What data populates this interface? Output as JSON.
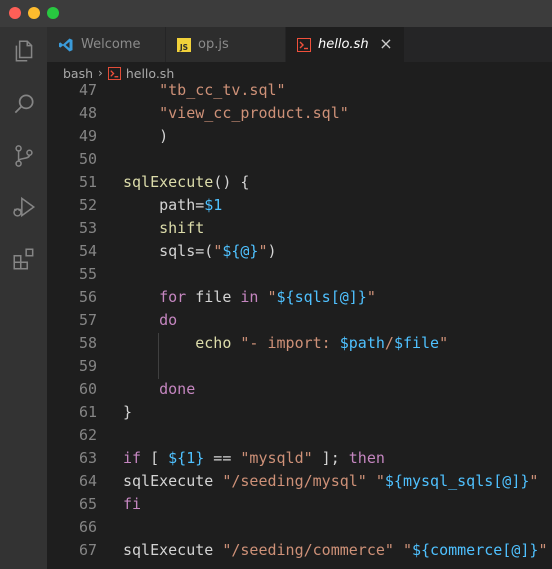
{
  "colors": {
    "keyword": "#c586c0",
    "string": "#ce9178",
    "variable": "#4fc1ff",
    "function": "#dcdcaa",
    "plain": "#d4d4d4",
    "line_number": "#858585",
    "editor_bg": "#1e1e1e",
    "accent_vscode_blue": "#3b9cdb",
    "js_yellow": "#f1d13a",
    "shell_orange": "#f0503b"
  },
  "activity_bar": [
    {
      "name": "explorer-icon"
    },
    {
      "name": "search-icon"
    },
    {
      "name": "source-control-icon"
    },
    {
      "name": "run-debug-icon"
    },
    {
      "name": "extensions-icon"
    }
  ],
  "tabs": [
    {
      "label": "Welcome",
      "icon": "vscode-logo-icon",
      "active": false
    },
    {
      "label": "op.js",
      "icon": "js-file-icon",
      "active": false
    },
    {
      "label": "hello.sh",
      "icon": "shell-file-icon",
      "active": true,
      "close_symbol": "×"
    }
  ],
  "breadcrumbs": {
    "folder": "bash",
    "separator": "›",
    "file": "hello.sh",
    "file_icon": "shell-file-icon"
  },
  "editor": {
    "lines": [
      {
        "n": "47",
        "tokens": [
          {
            "t": "    ",
            "c": "plain"
          },
          {
            "t": "\"tb_cc_tv.sql\"",
            "c": "str"
          }
        ]
      },
      {
        "n": "48",
        "tokens": [
          {
            "t": "    ",
            "c": "plain"
          },
          {
            "t": "\"view_cc_product.sql\"",
            "c": "str"
          }
        ]
      },
      {
        "n": "49",
        "tokens": [
          {
            "t": "    )",
            "c": "plain"
          }
        ]
      },
      {
        "n": "50",
        "tokens": []
      },
      {
        "n": "51",
        "tokens": [
          {
            "t": "sqlExecute",
            "c": "fn"
          },
          {
            "t": "() {",
            "c": "plain"
          }
        ]
      },
      {
        "n": "52",
        "tokens": [
          {
            "t": "    path=",
            "c": "plain"
          },
          {
            "t": "$1",
            "c": "var"
          }
        ]
      },
      {
        "n": "53",
        "tokens": [
          {
            "t": "    ",
            "c": "plain"
          },
          {
            "t": "shift",
            "c": "cmd"
          }
        ]
      },
      {
        "n": "54",
        "tokens": [
          {
            "t": "    sqls=(",
            "c": "plain"
          },
          {
            "t": "\"",
            "c": "str"
          },
          {
            "t": "${@}",
            "c": "var"
          },
          {
            "t": "\"",
            "c": "str"
          },
          {
            "t": ")",
            "c": "plain"
          }
        ]
      },
      {
        "n": "55",
        "tokens": []
      },
      {
        "n": "56",
        "tokens": [
          {
            "t": "    ",
            "c": "plain"
          },
          {
            "t": "for",
            "c": "kw"
          },
          {
            "t": " file ",
            "c": "plain"
          },
          {
            "t": "in",
            "c": "kw"
          },
          {
            "t": " ",
            "c": "plain"
          },
          {
            "t": "\"",
            "c": "str"
          },
          {
            "t": "${sqls[@]}",
            "c": "var"
          },
          {
            "t": "\"",
            "c": "str"
          }
        ]
      },
      {
        "n": "57",
        "tokens": [
          {
            "t": "    ",
            "c": "plain"
          },
          {
            "t": "do",
            "c": "kw"
          }
        ]
      },
      {
        "n": "58",
        "tokens": [
          {
            "t": "        ",
            "c": "plain"
          },
          {
            "t": "echo",
            "c": "cmd"
          },
          {
            "t": " ",
            "c": "plain"
          },
          {
            "t": "\"- import: ",
            "c": "str"
          },
          {
            "t": "$path",
            "c": "var"
          },
          {
            "t": "/",
            "c": "str"
          },
          {
            "t": "$file",
            "c": "var"
          },
          {
            "t": "\"",
            "c": "str"
          }
        ]
      },
      {
        "n": "59",
        "tokens": []
      },
      {
        "n": "60",
        "tokens": [
          {
            "t": "    ",
            "c": "plain"
          },
          {
            "t": "done",
            "c": "kw"
          }
        ]
      },
      {
        "n": "61",
        "tokens": [
          {
            "t": "}",
            "c": "plain"
          }
        ]
      },
      {
        "n": "62",
        "tokens": []
      },
      {
        "n": "63",
        "tokens": [
          {
            "t": "if",
            "c": "kw"
          },
          {
            "t": " [ ",
            "c": "plain"
          },
          {
            "t": "${1}",
            "c": "var"
          },
          {
            "t": " == ",
            "c": "plain"
          },
          {
            "t": "\"mysqld\"",
            "c": "str"
          },
          {
            "t": " ]; ",
            "c": "plain"
          },
          {
            "t": "then",
            "c": "kw"
          }
        ]
      },
      {
        "n": "64",
        "tokens": [
          {
            "t": "sqlExecute",
            "c": "plain"
          },
          {
            "t": " ",
            "c": "plain"
          },
          {
            "t": "\"/seeding/mysql\"",
            "c": "str"
          },
          {
            "t": " ",
            "c": "plain"
          },
          {
            "t": "\"",
            "c": "str"
          },
          {
            "t": "${mysql_sqls[@]}",
            "c": "var"
          },
          {
            "t": "\"",
            "c": "str"
          }
        ]
      },
      {
        "n": "65",
        "tokens": [
          {
            "t": "fi",
            "c": "kw"
          }
        ]
      },
      {
        "n": "66",
        "tokens": []
      },
      {
        "n": "67",
        "tokens": [
          {
            "t": "sqlExecute",
            "c": "plain"
          },
          {
            "t": " ",
            "c": "plain"
          },
          {
            "t": "\"/seeding/commerce\"",
            "c": "str"
          },
          {
            "t": " ",
            "c": "plain"
          },
          {
            "t": "\"",
            "c": "str"
          },
          {
            "t": "${commerce[@]}",
            "c": "var"
          },
          {
            "t": "\"",
            "c": "str"
          }
        ]
      }
    ]
  }
}
